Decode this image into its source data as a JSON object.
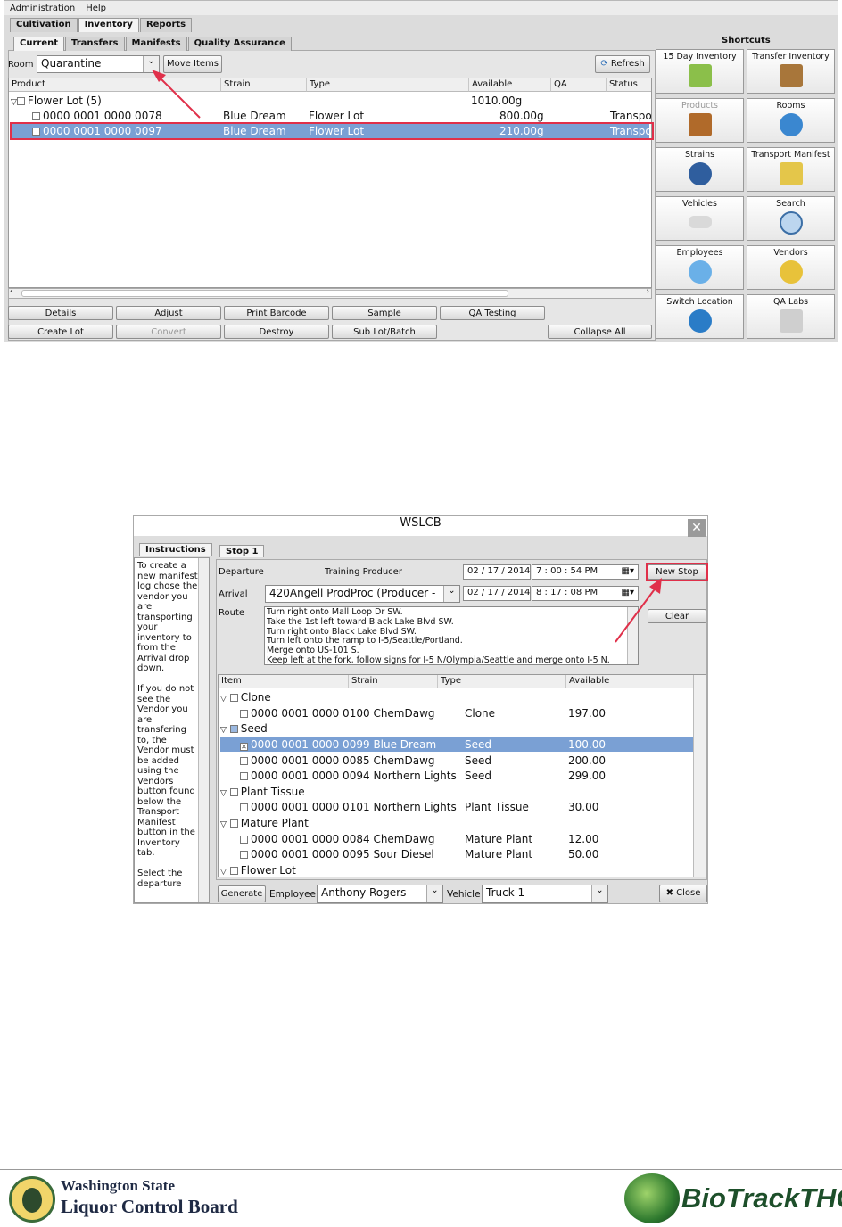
{
  "shot1": {
    "menu": [
      "Administration",
      "Help"
    ],
    "top_tabs": [
      "Cultivation",
      "Inventory",
      "Reports"
    ],
    "sub_tabs": [
      "Current",
      "Transfers",
      "Manifests",
      "Quality Assurance"
    ],
    "room_label": "Room",
    "room_value": "Quarantine",
    "move_items": "Move Items",
    "refresh": "Refresh",
    "columns": [
      "Product",
      "Strain",
      "Type",
      "Available",
      "QA",
      "Status"
    ],
    "group": {
      "label": "Flower Lot (5)",
      "available": "1010.00g"
    },
    "rows": [
      {
        "product": "0000 0001 0000 0078",
        "strain": "Blue Dream",
        "type": "Flower Lot",
        "available": "800.00g",
        "status": "Transpo"
      },
      {
        "product": "0000 0001 0000 0097",
        "strain": "Blue Dream",
        "type": "Flower Lot",
        "available": "210.00g",
        "status": "Transpo"
      }
    ],
    "buttons_row1": [
      "Details",
      "Adjust",
      "Print Barcode",
      "Sample",
      "QA Testing"
    ],
    "buttons_row2": [
      "Create Lot",
      "Convert",
      "Destroy",
      "Sub Lot/Batch",
      "Collapse All"
    ],
    "shortcuts_title": "Shortcuts",
    "shortcuts": [
      "15 Day Inventory",
      "Transfer Inventory",
      "Products",
      "Rooms",
      "Strains",
      "Transport Manifest",
      "Vehicles",
      "Search",
      "Employees",
      "Vendors",
      "Switch Location",
      "QA Labs"
    ]
  },
  "shot2": {
    "title": "WSLCB",
    "instructions_tab": "Instructions",
    "instructions_text": "To create a new manifest log chose the vendor you are transporting your inventory to from the Arrival drop down.\n\nIf you do not see the Vendor you are transfering to, the Vendor must be added using the Vendors button found below the Transport Manifest button in the Inventory tab.\n\nSelect the departure",
    "stop_tab": "Stop 1",
    "departure_label": "Departure",
    "departure_value": "Training Producer",
    "departure_date": "02 / 17 / 2014",
    "departure_time": "7 : 00 : 54   PM",
    "arrival_label": "Arrival",
    "arrival_value": "420Angell ProdProc (Producer -",
    "arrival_date": "02 / 17 / 2014",
    "arrival_time": "8 : 17 : 08   PM",
    "route_label": "Route",
    "route_lines": [
      "Turn right onto Mall Loop Dr SW.",
      "Take the 1st left toward Black Lake Blvd SW.",
      "Turn right onto Black Lake Blvd SW.",
      "Turn left onto the ramp to I-5/Seattle/Portland.",
      "Merge onto US-101 S.",
      "Keep left at the fork, follow signs for I-5 N/Olympia/Seattle and merge onto I-5 N."
    ],
    "new_stop": "New Stop",
    "clear": "Clear",
    "columns": [
      "Item",
      "Strain",
      "Type",
      "Available"
    ],
    "items": [
      {
        "kind": "group",
        "label": "Clone"
      },
      {
        "kind": "row",
        "item": "0000 0001 0000 0100",
        "strain": "ChemDawg",
        "type": "Clone",
        "available": "197.00"
      },
      {
        "kind": "group",
        "label": "Seed"
      },
      {
        "kind": "row",
        "item": "0000 0001 0000 0099",
        "strain": "Blue Dream",
        "type": "Seed",
        "available": "100.00"
      },
      {
        "kind": "row",
        "item": "0000 0001 0000 0085",
        "strain": "ChemDawg",
        "type": "Seed",
        "available": "200.00"
      },
      {
        "kind": "row",
        "item": "0000 0001 0000 0094",
        "strain": "Northern Lights",
        "type": "Seed",
        "available": "299.00"
      },
      {
        "kind": "group",
        "label": "Plant Tissue"
      },
      {
        "kind": "row",
        "item": "0000 0001 0000 0101",
        "strain": "Northern Lights",
        "type": "Plant Tissue",
        "available": "30.00"
      },
      {
        "kind": "group",
        "label": "Mature Plant"
      },
      {
        "kind": "row",
        "item": "0000 0001 0000 0084",
        "strain": "ChemDawg",
        "type": "Mature Plant",
        "available": "12.00"
      },
      {
        "kind": "row",
        "item": "0000 0001 0000 0095",
        "strain": "Sour Diesel",
        "type": "Mature Plant",
        "available": "50.00"
      },
      {
        "kind": "group",
        "label": "Flower Lot"
      }
    ],
    "generate": "Generate",
    "employee_label": "Employee",
    "employee_value": "Anthony Rogers",
    "vehicle_label": "Vehicle",
    "vehicle_value": "Truck 1",
    "close": "Close"
  },
  "footer": {
    "left_logo": [
      "Washington State",
      "Liquor Control Board"
    ],
    "right_logo": "BioTrackTHC"
  },
  "colors": {
    "selection": "#7aa0d4",
    "highlight_box": "#e0304a"
  }
}
